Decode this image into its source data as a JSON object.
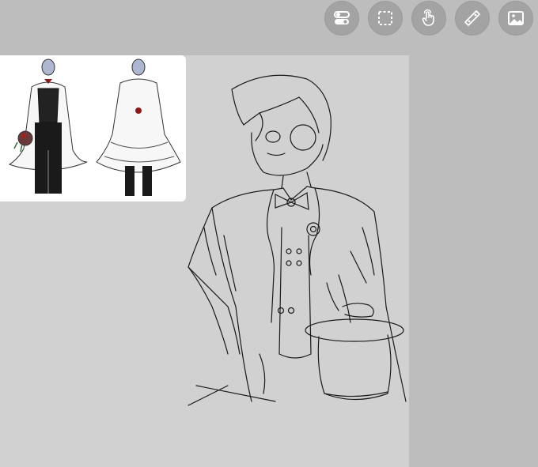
{
  "toolbar": {
    "tools": [
      {
        "name": "toggle-icon"
      },
      {
        "name": "selection-icon"
      },
      {
        "name": "hand-tap-icon"
      },
      {
        "name": "ruler-icon"
      },
      {
        "name": "image-icon"
      }
    ]
  },
  "colors": {
    "workspace": "#bdbdbd",
    "canvas": "#d1d1d1",
    "tool_button": "#a3a3a3",
    "icon": "#ffffff",
    "line": "#1a1a1a",
    "accent_red": "#7a1a1a"
  }
}
